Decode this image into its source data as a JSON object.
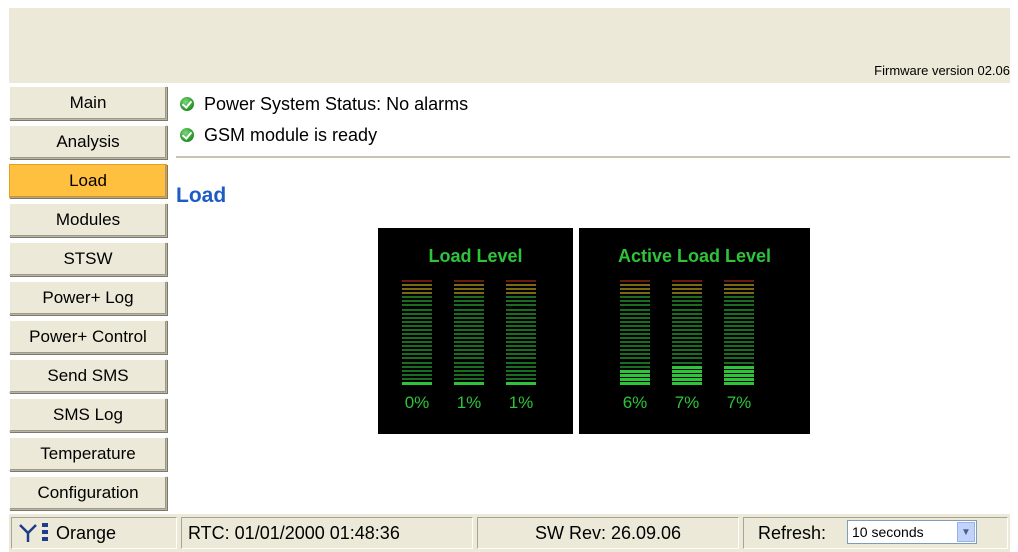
{
  "header": {
    "firmware": "Firmware version 02.06"
  },
  "sidebar": {
    "items": [
      {
        "label": "Main"
      },
      {
        "label": "Analysis"
      },
      {
        "label": "Load",
        "active": true
      },
      {
        "label": "Modules"
      },
      {
        "label": "STSW"
      },
      {
        "label": "Power+ Log"
      },
      {
        "label": "Power+ Control"
      },
      {
        "label": "Send SMS"
      },
      {
        "label": "SMS Log"
      },
      {
        "label": "Temperature"
      },
      {
        "label": "Configuration"
      }
    ]
  },
  "status": {
    "line1": "Power System Status:  No alarms",
    "line2": "GSM module is ready"
  },
  "main": {
    "title": "Load",
    "panels": [
      {
        "title": "Load Level",
        "bars": [
          {
            "label": "0%",
            "value": 0
          },
          {
            "label": "1%",
            "value": 1
          },
          {
            "label": "1%",
            "value": 1
          }
        ]
      },
      {
        "title": "Active Load Level",
        "bars": [
          {
            "label": "6%",
            "value": 6
          },
          {
            "label": "7%",
            "value": 7
          },
          {
            "label": "7%",
            "value": 7
          }
        ]
      }
    ]
  },
  "footer": {
    "operator": "Orange",
    "rtc": "RTC: 01/01/2000 01:48:36",
    "sw_rev": "SW Rev: 26.09.06",
    "refresh_label": "Refresh:",
    "refresh_value": "10 seconds"
  },
  "icons": {
    "status_ok": "check-circle-icon",
    "antenna": "antenna-icon",
    "signal": "signal-bars-icon",
    "dropdown": "chevron-down-icon"
  },
  "colors": {
    "accent_title": "#1e5bc6",
    "active_nav": "#ffc040",
    "meter_green": "#2ec43a",
    "meter_yellow": "#e0c020",
    "meter_red": "#c03020"
  }
}
